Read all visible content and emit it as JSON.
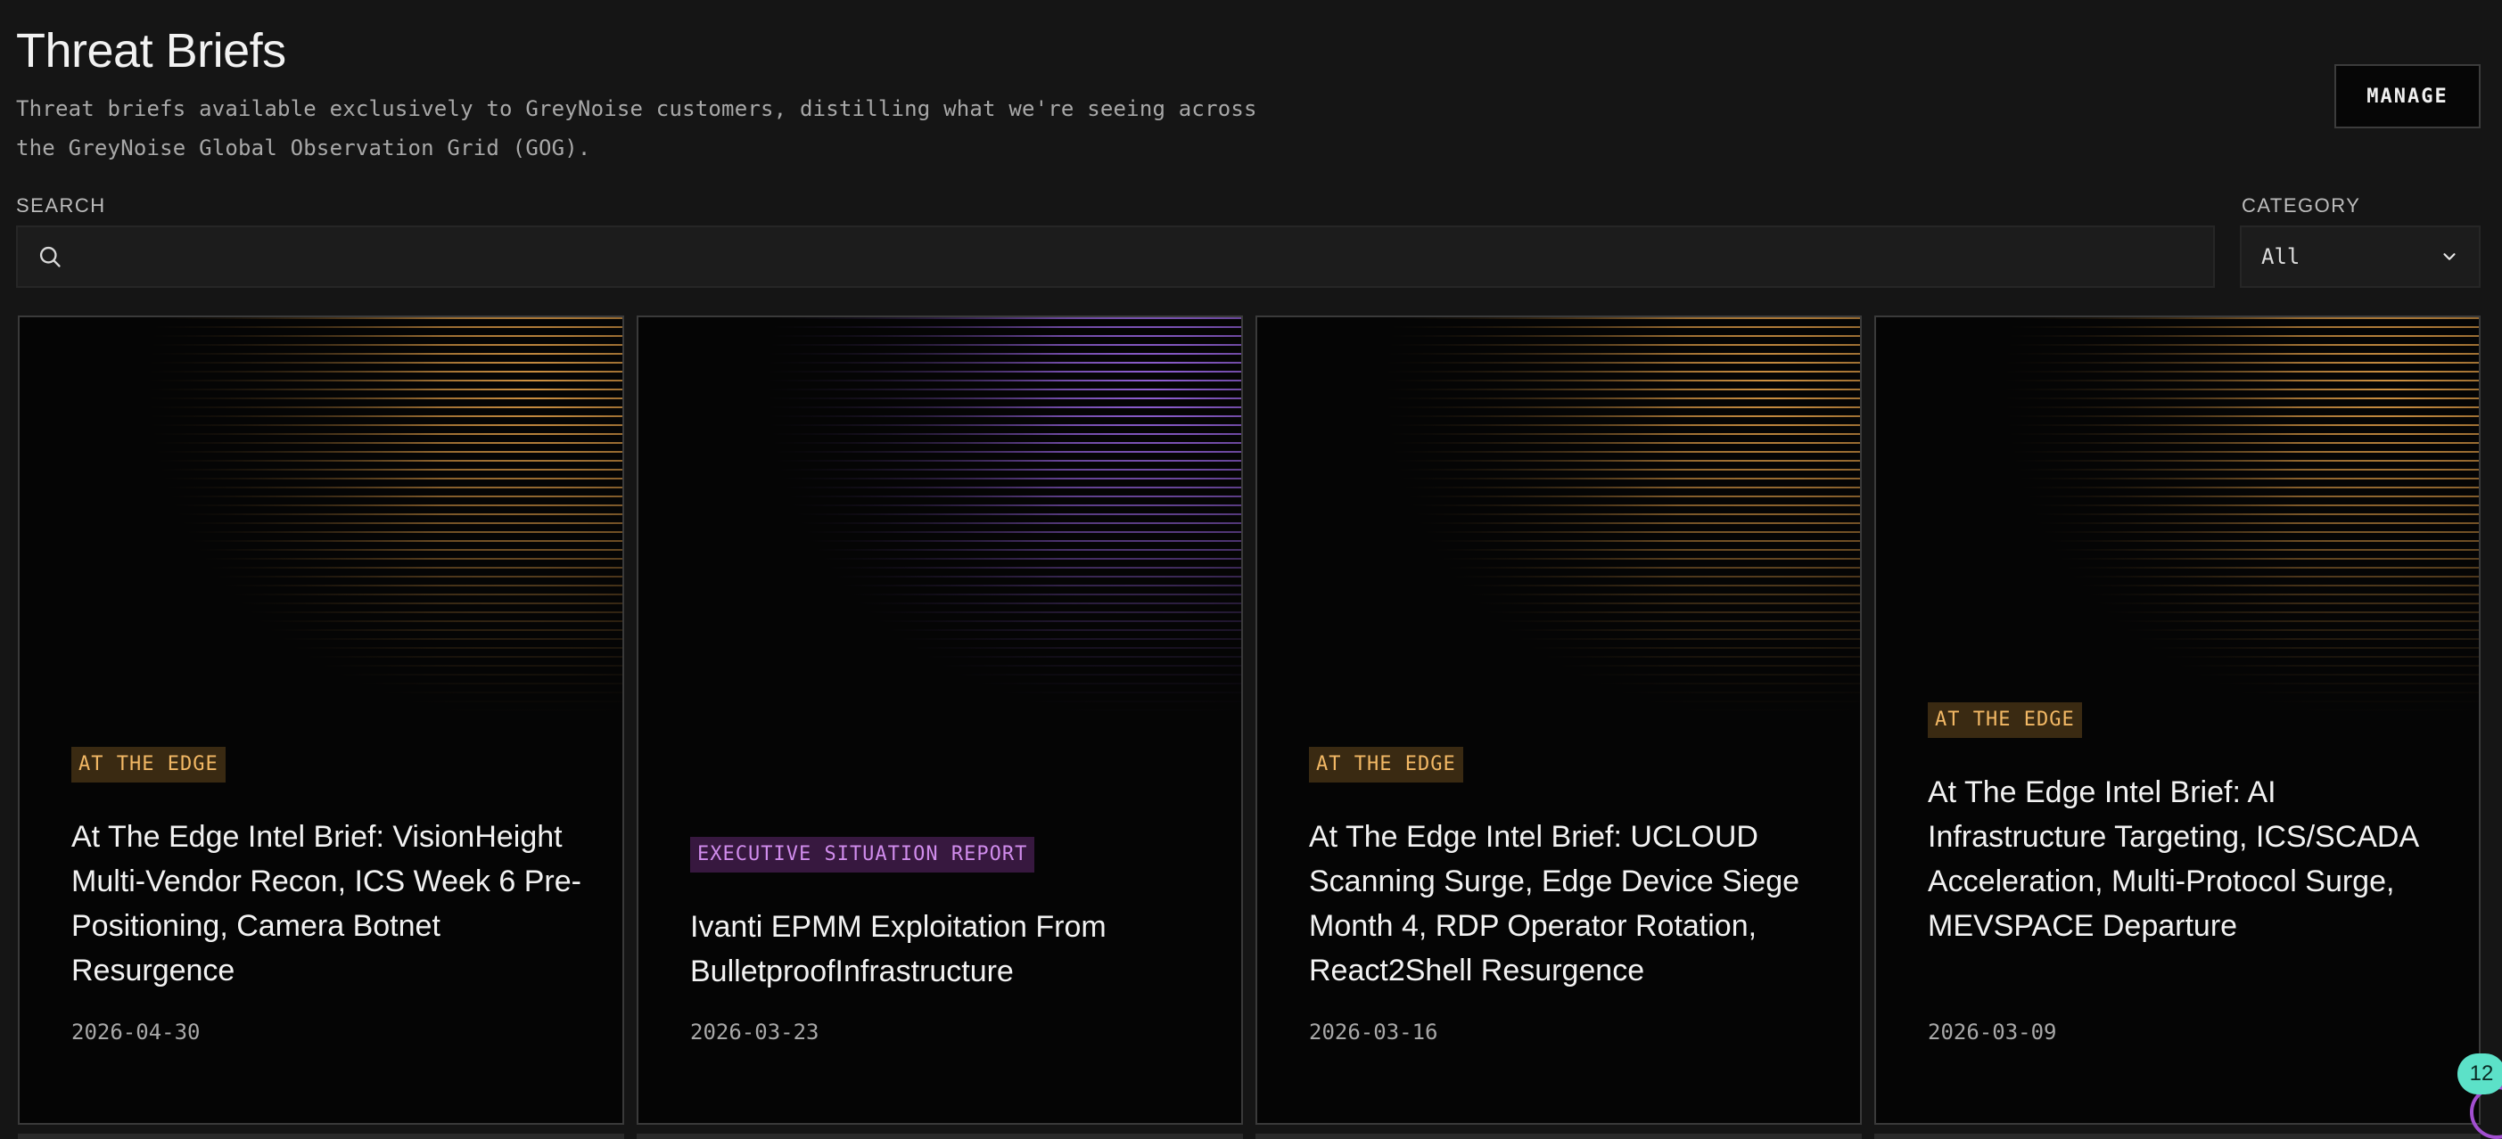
{
  "header": {
    "title": "Threat Briefs",
    "subtitle_line1": "Threat briefs available exclusively to GreyNoise customers, distilling what we're seeing across",
    "subtitle_line2": "the GreyNoise Global Observation Grid (GOG).",
    "manage_label": "MANAGE"
  },
  "filters": {
    "search_label": "SEARCH",
    "search_value": "",
    "search_icon": "search-icon",
    "category_label": "CATEGORY",
    "category_value": "All",
    "category_icon": "chevron-down-icon"
  },
  "cards": [
    {
      "category": "AT THE EDGE",
      "accent": "#e8a34a",
      "title": "At The Edge Intel Brief: VisionHeight Multi-Vendor Recon, ICS Week 6 Pre-Positioning, Camera Botnet Resurgence",
      "date": "2026-04-30"
    },
    {
      "category": "EXECUTIVE SITUATION REPORT",
      "accent": "#a36cf0",
      "title": "Ivanti EPMM Exploitation From BulletproofInfrastructure",
      "date": "2026-03-23"
    },
    {
      "category": "AT THE EDGE",
      "accent": "#e8a34a",
      "title": "At The Edge Intel Brief: UCLOUD Scanning Surge, Edge Device Siege Month 4, RDP Operator Rotation, React2Shell Resurgence",
      "date": "2026-03-16"
    },
    {
      "category": "AT THE EDGE",
      "accent": "#e8a34a",
      "title": "At The Edge Intel Brief: AI Infrastructure Targeting, ICS/SCADA Acceleration, Multi-Protocol Surge, MEVSPACE Departure",
      "date": "2026-03-09"
    }
  ],
  "chat_widget": {
    "count": "12",
    "accent": "#5ce1c8"
  }
}
